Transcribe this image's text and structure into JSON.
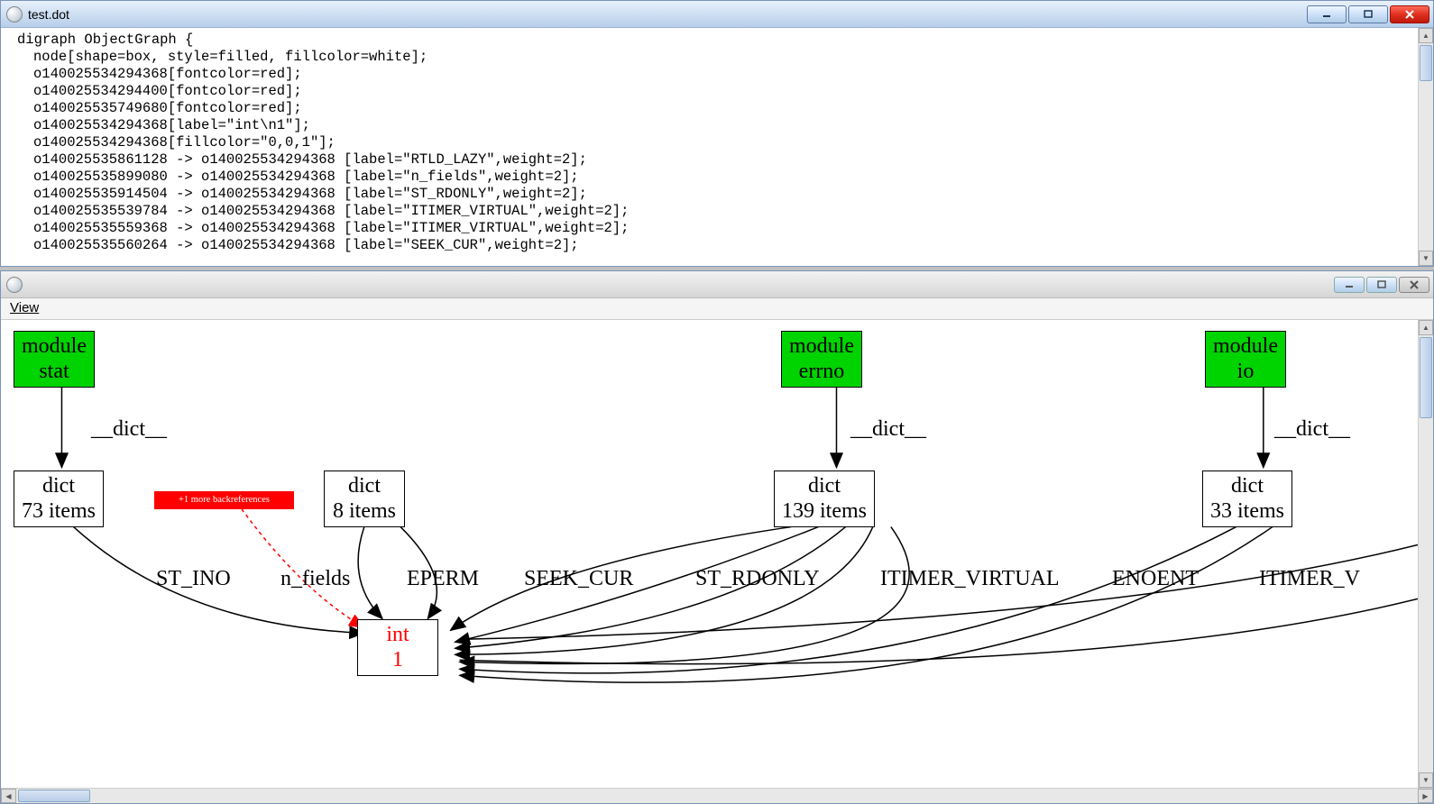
{
  "window1": {
    "title": "test.dot",
    "lines": [
      "digraph ObjectGraph {",
      "node[shape=box, style=filled, fillcolor=white];",
      "o140025534294368[fontcolor=red];",
      "o140025534294400[fontcolor=red];",
      "o140025535749680[fontcolor=red];",
      "o140025534294368[label=\"int\\n1\"];",
      "o140025534294368[fillcolor=\"0,0,1\"];",
      "o140025535861128 -> o140025534294368 [label=\"RTLD_LAZY\",weight=2];",
      "o140025535899080 -> o140025534294368 [label=\"n_fields\",weight=2];",
      "o140025535914504 -> o140025534294368 [label=\"ST_RDONLY\",weight=2];",
      "o140025535539784 -> o140025534294368 [label=\"ITIMER_VIRTUAL\",weight=2];",
      "o140025535559368 -> o140025534294368 [label=\"ITIMER_VIRTUAL\",weight=2];",
      "o140025535560264 -> o140025534294368 [label=\"SEEK_CUR\",weight=2];"
    ]
  },
  "window2": {
    "menu_view": "View",
    "nodes": {
      "mod_stat": {
        "l1": "module",
        "l2": "stat"
      },
      "mod_errno": {
        "l1": "module",
        "l2": "errno"
      },
      "mod_io": {
        "l1": "module",
        "l2": "io"
      },
      "dict73": {
        "l1": "dict",
        "l2": "73 items"
      },
      "dict8": {
        "l1": "dict",
        "l2": "8 items"
      },
      "dict139": {
        "l1": "dict",
        "l2": "139 items"
      },
      "dict33": {
        "l1": "dict",
        "l2": "33 items"
      },
      "int1": {
        "l1": "int",
        "l2": "1"
      },
      "more": "+1 more backreferences"
    },
    "edge_labels": {
      "dict1": "__dict__",
      "dict2": "__dict__",
      "dict3": "__dict__",
      "st_ino": "ST_INO",
      "n_fields": "n_fields",
      "eperm": "EPERM",
      "seek_cur": "SEEK_CUR",
      "st_rdonly": "ST_RDONLY",
      "itimer": "ITIMER_VIRTUAL",
      "enoent": "ENOENT",
      "itimer2": "ITIMER_V"
    }
  }
}
